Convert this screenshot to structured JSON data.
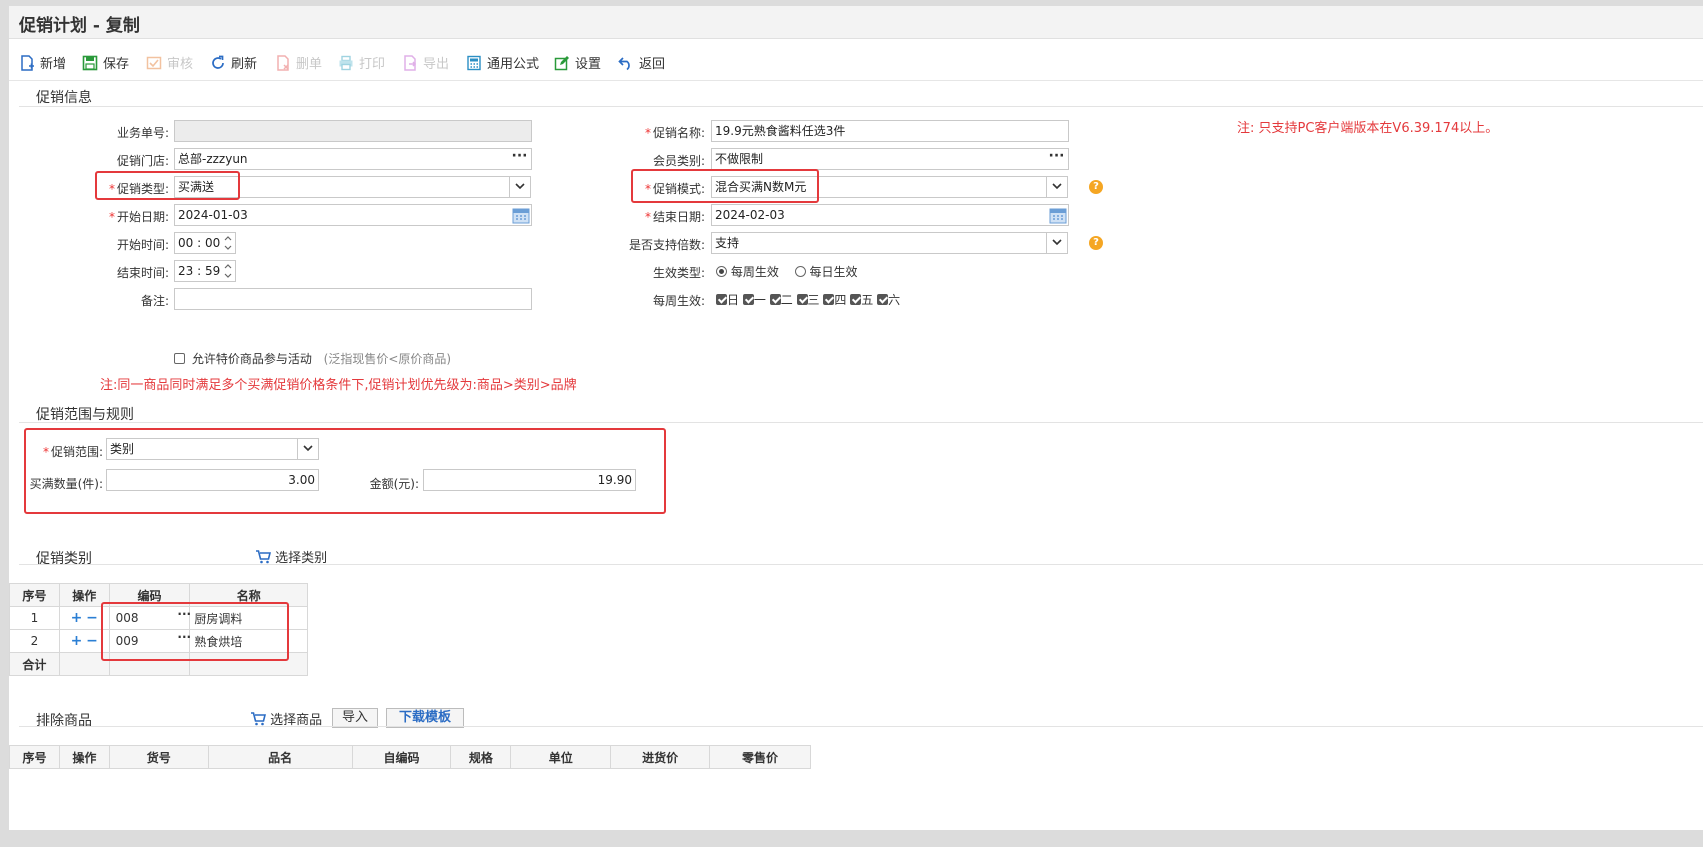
{
  "title": "促销计划 - 复制",
  "toolbar": {
    "new": "新增",
    "save": "保存",
    "audit": "审核",
    "refresh": "刷新",
    "delete": "删单",
    "print": "打印",
    "export": "导出",
    "formula": "通用公式",
    "settings": "设置",
    "back": "返回"
  },
  "section_info": "促销信息",
  "form": {
    "bill_no_label": "业务单号:",
    "bill_no": "",
    "store_label": "促销门店:",
    "store": "总部-zzzyun",
    "type_label": "促销类型:",
    "type": "买满送",
    "start_date_label": "开始日期:",
    "start_date": "2024-01-03",
    "start_time_label": "开始时间:",
    "start_time": "00 : 00",
    "end_time_label": "结束时间:",
    "end_time": "23 : 59",
    "remark_label": "备注:",
    "remark": "",
    "name_label": "促销名称:",
    "name": "19.9元熟食酱料任选3件",
    "member_label": "会员类别:",
    "member": "不做限制",
    "mode_label": "促销模式:",
    "mode": "混合买满N数M元",
    "end_date_label": "结束日期:",
    "end_date": "2024-02-03",
    "multiple_label": "是否支持倍数:",
    "multiple": "支持",
    "effect_type_label": "生效类型:",
    "effect_weekly": "每周生效",
    "effect_daily": "每日生效",
    "weekly_label": "每周生效:",
    "weekdays": [
      "日",
      "一",
      "二",
      "三",
      "四",
      "五",
      "六"
    ]
  },
  "notice_pc": "注: 只支持PC客户端版本在V6.39.174以上。",
  "allow_special": "允许特价商品参与活动",
  "allow_special_hint": "(泛指现售价<原价商品)",
  "notice_priority": "注:同一商品同时满足多个买满促销价格条件下,促销计划优先级为:商品>类别>品牌",
  "section_rules": "促销范围与规则",
  "rules": {
    "scope_label": "促销范围:",
    "scope": "类别",
    "qty_label": "买满数量(件):",
    "qty": "3.00",
    "amount_label": "金额(元):",
    "amount": "19.90"
  },
  "section_category": "促销类别",
  "select_category": "选择类别",
  "category_table": {
    "headers": [
      "序号",
      "操作",
      "编码",
      "名称"
    ],
    "rows": [
      {
        "no": "1",
        "code": "008",
        "name": "厨房调料"
      },
      {
        "no": "2",
        "code": "009",
        "name": "熟食烘培"
      }
    ],
    "total_label": "合计"
  },
  "section_exclude": "排除商品",
  "select_goods": "选择商品",
  "import": "导入",
  "download_template": "下载模板",
  "exclude_table": {
    "headers": [
      "序号",
      "操作",
      "货号",
      "品名",
      "自编码",
      "规格",
      "单位",
      "进货价",
      "零售价"
    ]
  }
}
